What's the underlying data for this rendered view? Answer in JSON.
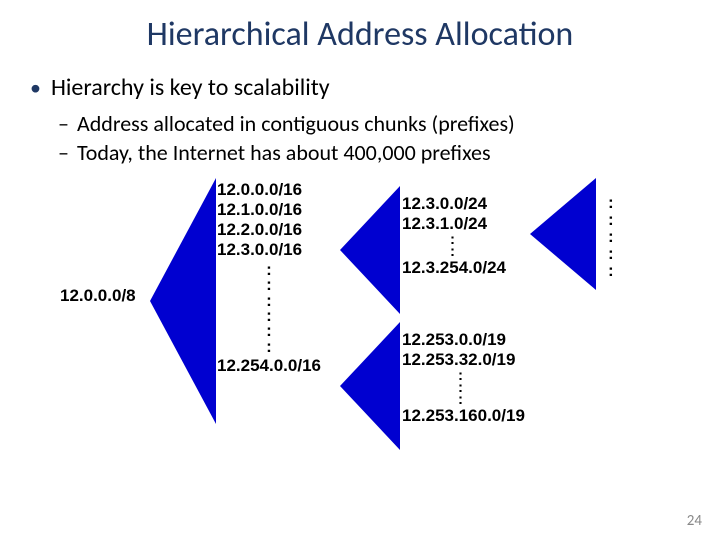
{
  "title": "Hierarchical Address Allocation",
  "bullet1": "Hierarchy is key to scalability",
  "bullet2a": "Address allocated in contiguous chunks (prefixes)",
  "bullet2b": "Today, the Internet has about 400,000 prefixes",
  "root": "12.0.0.0/8",
  "level1": {
    "a": "12.0.0.0/16",
    "b": "12.1.0.0/16",
    "c": "12.2.0.0/16",
    "d": "12.3.0.0/16",
    "last": "12.254.0.0/16"
  },
  "level2a": {
    "a": "12.3.0.0/24",
    "b": "12.3.1.0/24",
    "last": "12.3.254.0/24"
  },
  "level2b": {
    "a": "12.253.0.0/19",
    "b": "12.253.32.0/19",
    "last": "12.253.160.0/19"
  },
  "slide_number": "24",
  "colors": {
    "triangle": "#0000D0",
    "title": "#1F3864"
  }
}
